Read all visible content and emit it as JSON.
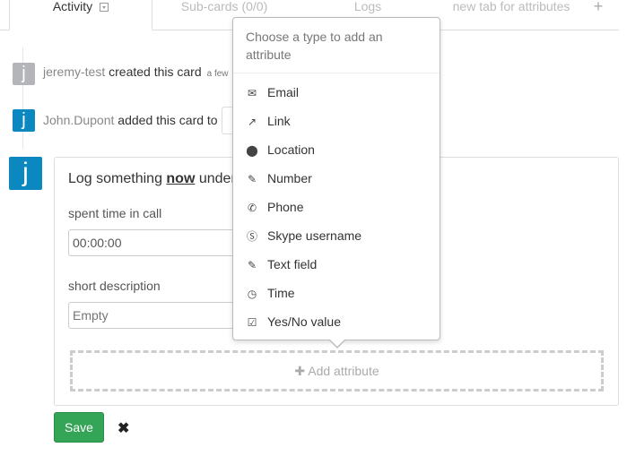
{
  "tabs": [
    {
      "label": "Activity",
      "active": true
    },
    {
      "label": "Sub-cards (0/0)"
    },
    {
      "label": "Logs"
    },
    {
      "label": "new tab for attributes"
    }
  ],
  "add_tab_icon": "plus-icon",
  "events": [
    {
      "avatar": "j",
      "avatar_color": "#b3b5b8",
      "user": "jeremy-test",
      "action": "created this card",
      "time": "a few"
    },
    {
      "avatar": "j",
      "avatar_color": "#0c88c1",
      "user": "John.Dupont",
      "action": "added this card to"
    }
  ],
  "log_form": {
    "avatar": "j",
    "avatar_color": "#0c88c1",
    "title_pre": "Log something ",
    "title_bold": "now",
    "title_post": " under",
    "fields": [
      {
        "label": "spent time in call",
        "value": "00:00:00"
      },
      {
        "label": "short description",
        "placeholder": "Empty"
      }
    ],
    "add_attribute": "Add attribute",
    "save": "Save",
    "accent": "#34a457"
  },
  "popover": {
    "title": "Choose a type to add an attribute",
    "items": [
      {
        "label": "Email",
        "icon": "envelope-icon",
        "glyph": "✉"
      },
      {
        "label": "Link",
        "icon": "external-link-icon",
        "glyph": "↗"
      },
      {
        "label": "Location",
        "icon": "map-marker-icon",
        "glyph": "⬤"
      },
      {
        "label": "Number",
        "icon": "edit-icon",
        "glyph": "✎"
      },
      {
        "label": "Phone",
        "icon": "phone-icon",
        "glyph": "✆"
      },
      {
        "label": "Skype username",
        "icon": "skype-icon",
        "glyph": "Ⓢ"
      },
      {
        "label": "Text field",
        "icon": "edit-icon",
        "glyph": "✎"
      },
      {
        "label": "Time",
        "icon": "clock-icon",
        "glyph": "◷"
      },
      {
        "label": "Yes/No value",
        "icon": "check-square-icon",
        "glyph": "☑"
      }
    ]
  }
}
